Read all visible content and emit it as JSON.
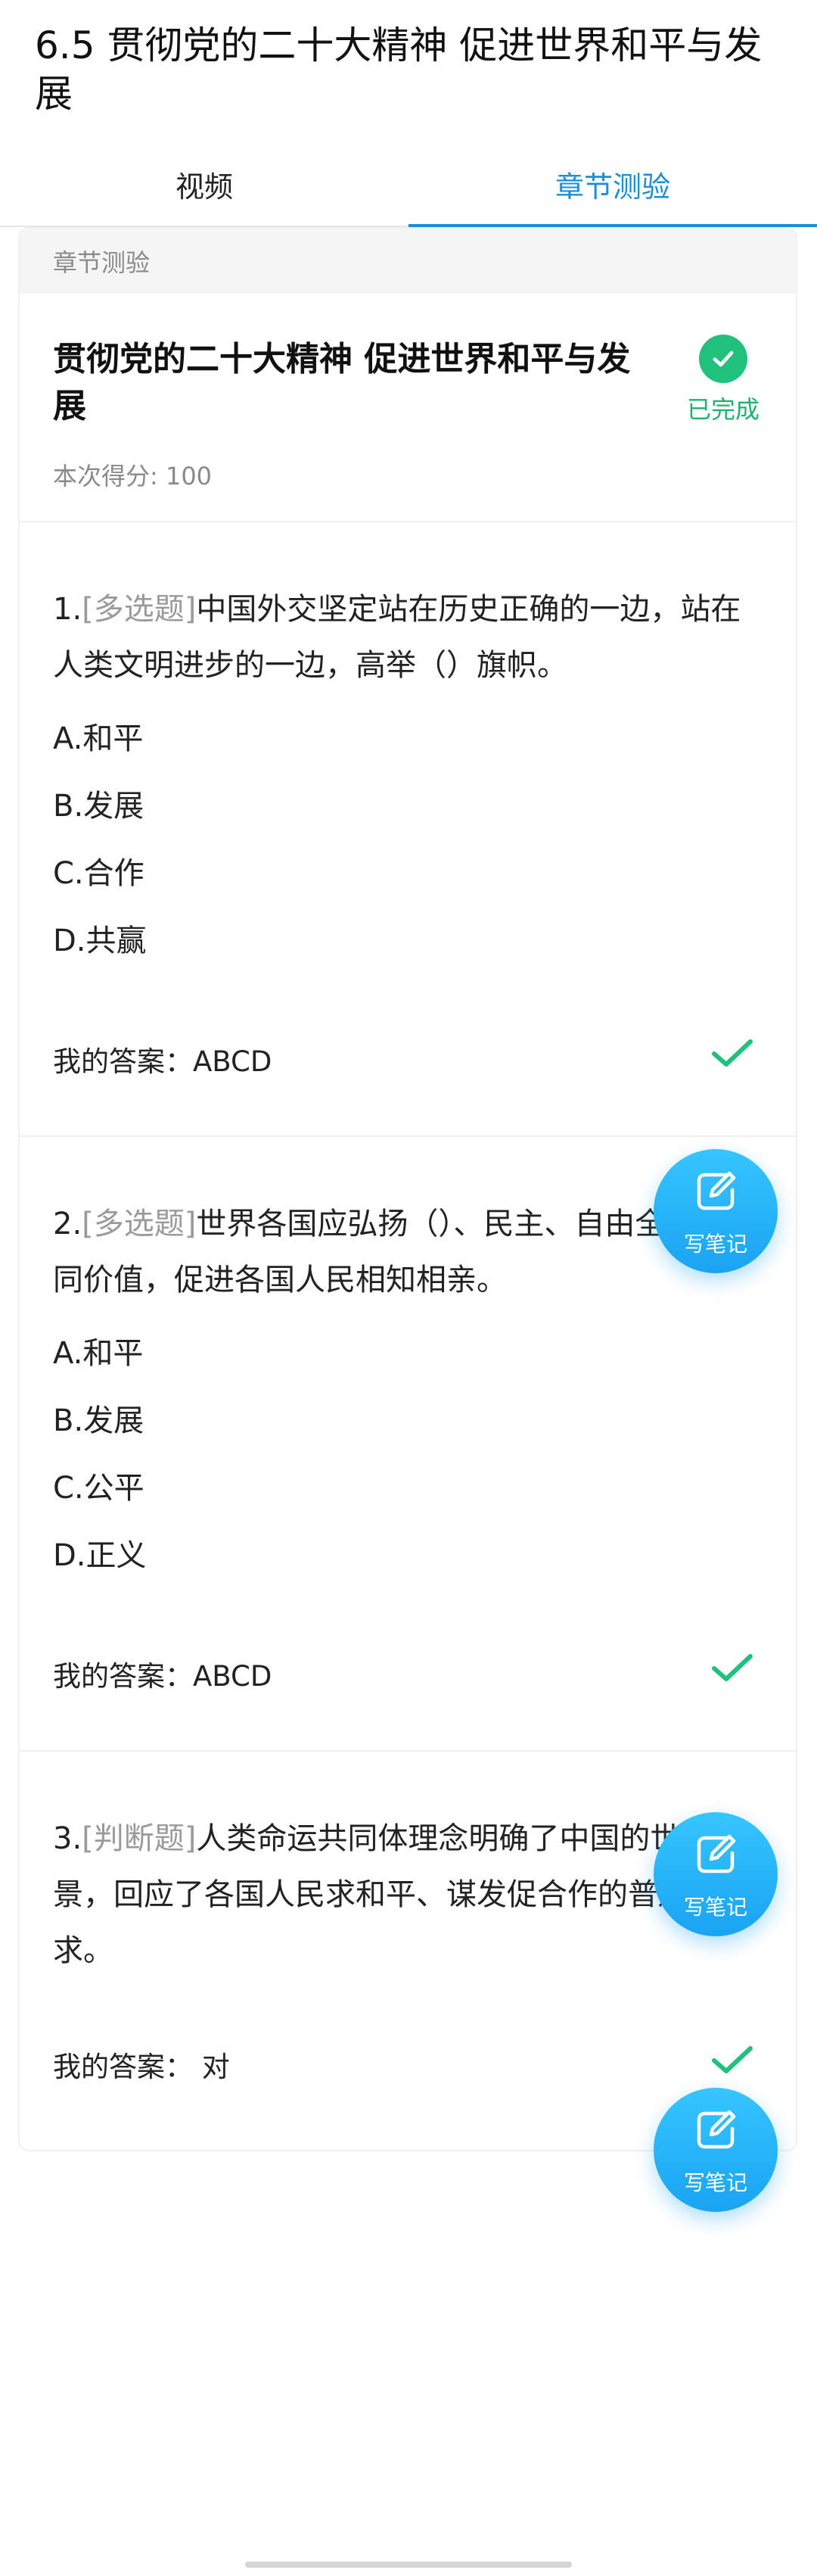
{
  "header": {
    "title": "6.5 贯彻党的二十大精神 促进世界和平与发展"
  },
  "tabs": [
    {
      "label": "视频",
      "active": false
    },
    {
      "label": "章节测验",
      "active": true
    }
  ],
  "quiz": {
    "section_label": "章节测验",
    "title": "贯彻党的二十大精神 促进世界和平与发展",
    "status": "已完成",
    "score_text": "本次得分: 100"
  },
  "questions": [
    {
      "number": "1.",
      "type": "[多选题]",
      "text": "中国外交坚定站在历史正确的一边，站在人类文明进步的一边，高举（）旗帜。",
      "options": [
        "A.和平",
        "B.发展",
        "C.合作",
        "D.共赢"
      ],
      "answer": "我的答案：ABCD"
    },
    {
      "number": "2.",
      "type": "[多选题]",
      "text": "世界各国应弘扬（）、民主、自由全人类共同价值，促进各国人民相知相亲。",
      "options": [
        "A.和平",
        "B.发展",
        "C.公平",
        "D.正义"
      ],
      "answer": "我的答案：ABCD"
    },
    {
      "number": "3.",
      "type": "[判断题]",
      "text": "人类命运共同体理念明确了中国的世界愿景，回应了各国人民求和平、谋发促合作的普遍诉求。",
      "options": [],
      "answer": "我的答案： 对"
    }
  ],
  "note_button": {
    "label": "写笔记"
  },
  "colors": {
    "accent_blue": "#1a8fd6",
    "success_green": "#20c07d",
    "note_blue": "#1aa3f2",
    "muted_gray": "#8a8a8a"
  }
}
